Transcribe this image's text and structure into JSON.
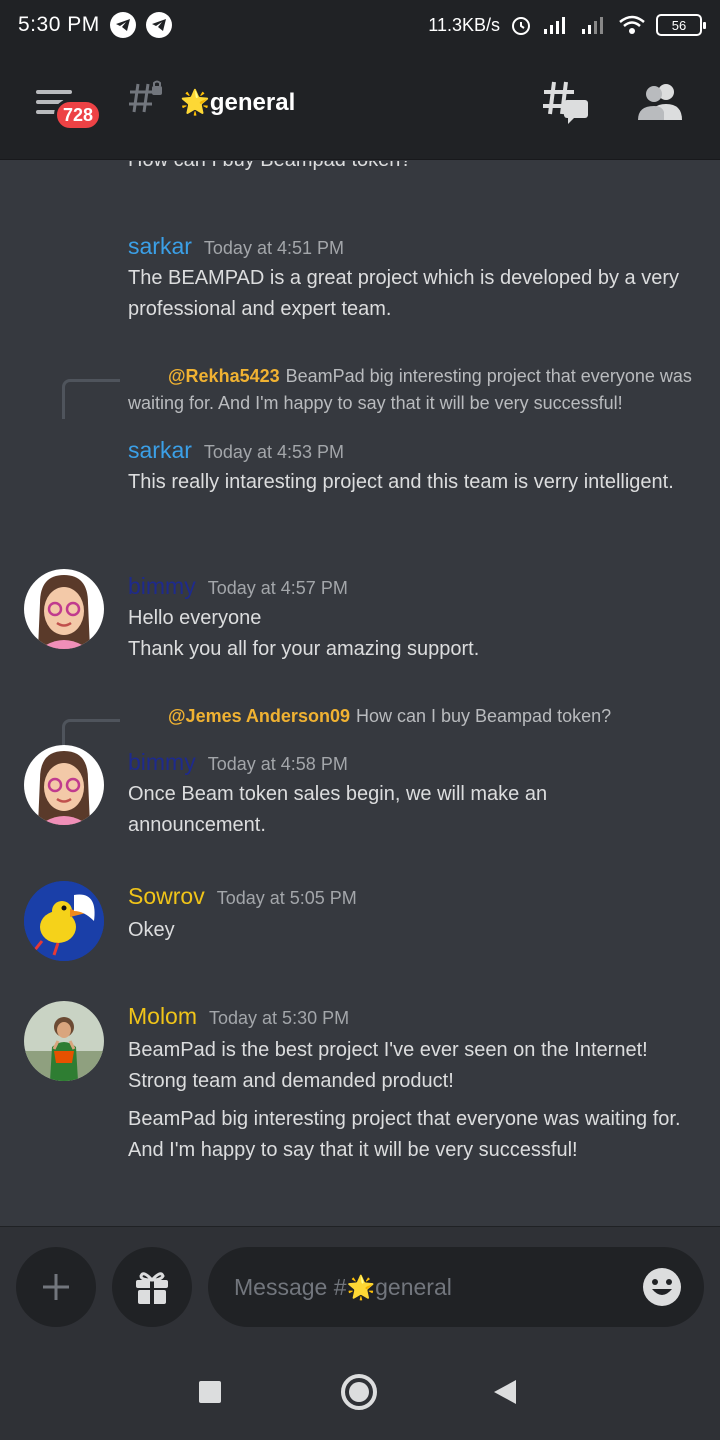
{
  "status_bar": {
    "time": "5:30 PM",
    "network_speed": "11.3KB/s",
    "battery": "56"
  },
  "header": {
    "unread_badge": "728",
    "channel_name": "🌟general"
  },
  "cut_off_text": "How can I buy Beampad token?",
  "messages": [
    {
      "author": "sarkar",
      "author_color": "#3ba0e8",
      "time": "Today at 4:51 PM",
      "lines": [
        "The BEAMPAD is a great project which is developed by a very professional and expert team."
      ]
    },
    {
      "reply_mention": "@Rekha5423",
      "reply_text": "BeamPad big interesting project that everyone was waiting for. And I'm happy to say that it will be very successful!",
      "author": "sarkar",
      "author_color": "#3ba0e8",
      "time": "Today at 4:53 PM",
      "lines": [
        "This really intaresting project and this team is verry intelligent."
      ]
    },
    {
      "author": "bimmy",
      "author_color": "#1e2a8c",
      "time": "Today at 4:57 PM",
      "lines": [
        "Hello everyone",
        "Thank you all for your amazing support."
      ]
    },
    {
      "reply_mention": "@Jemes Anderson09",
      "reply_text": "How can I buy Beampad token?",
      "author": "bimmy",
      "author_color": "#1e2a8c",
      "time": "Today at 4:58 PM",
      "lines": [
        "Once Beam token sales begin, we will make an announcement."
      ]
    },
    {
      "author": "Sowrov",
      "author_color": "#f0c419",
      "time": "Today at 5:05 PM",
      "lines": [
        "Okey"
      ]
    },
    {
      "author": "Molom",
      "author_color": "#f0c419",
      "time": "Today at 5:30 PM",
      "lines": [
        "BeamPad is the best project I've ever seen on the Internet! Strong team and demanded product!"
      ],
      "followup": "BeamPad big interesting project that everyone was waiting for. And I'm happy to say that it will be very successful!"
    }
  ],
  "composer": {
    "placeholder": "Message #🌟general"
  },
  "icons": {
    "menu": "hamburger-icon",
    "channel": "locked-hash-icon",
    "threads": "threads-icon",
    "members": "members-icon",
    "add": "plus-icon",
    "gift": "gift-icon",
    "emoji": "emoji-icon"
  }
}
